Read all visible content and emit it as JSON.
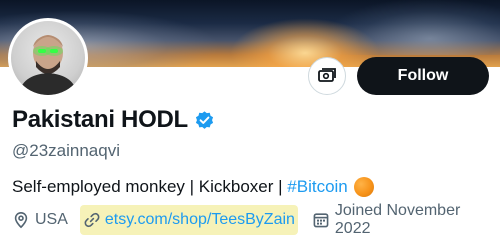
{
  "profile": {
    "display_name": "Pakistani HODL",
    "handle": "@23zainnaqvi",
    "bio_text": "Self-employed monkey | Kickboxer | ",
    "bio_hashtag": "#Bitcoin",
    "location": "USA",
    "website": "etsy.com/shop/TeesByZain",
    "joined": "Joined November 2022",
    "verified": true
  },
  "actions": {
    "follow_label": "Follow",
    "more_icon": "money-icon"
  },
  "icons": {
    "location": "location-pin-icon",
    "link": "link-icon",
    "calendar": "calendar-icon",
    "verified": "verified-badge-icon",
    "coin": "bitcoin-coin-icon"
  },
  "colors": {
    "accent": "#1d9bf0",
    "text": "#0f1419",
    "secondary": "#536471",
    "follow_bg": "#0f1419",
    "link_highlight": "#f6f2b8"
  }
}
